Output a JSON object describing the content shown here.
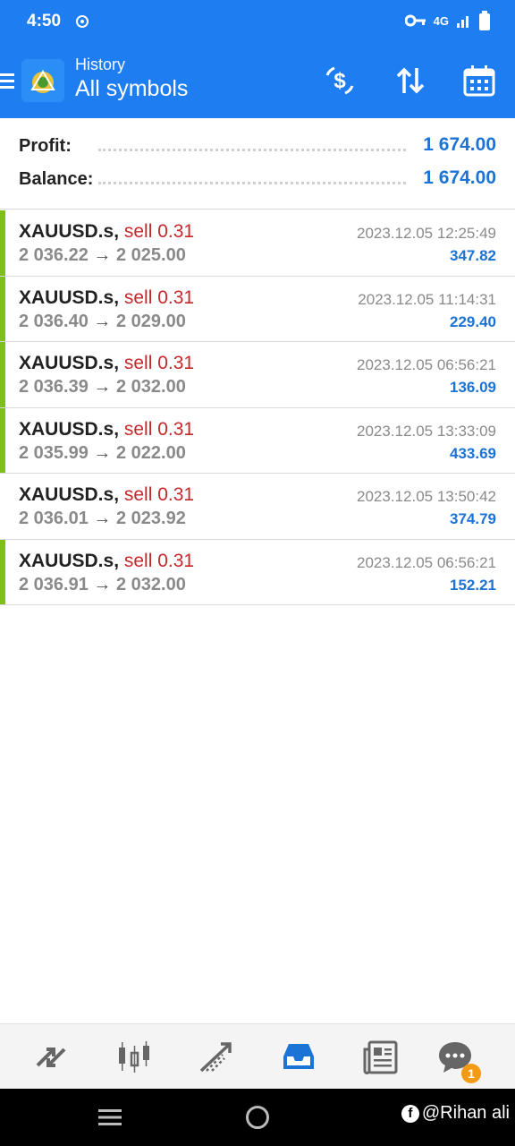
{
  "status": {
    "time": "4:50",
    "network": "4G"
  },
  "header": {
    "subtitle": "History",
    "title": "All symbols"
  },
  "summary": {
    "profit_label": "Profit:",
    "profit_value": "1 674.00",
    "balance_label": "Balance:",
    "balance_value": "1 674.00"
  },
  "deals": [
    {
      "symbol": "XAUUSD.s,",
      "side": "sell 0.31",
      "open": "2 036.22",
      "arrow": "→",
      "close": "2 025.00",
      "time": "2023.12.05 12:25:49",
      "profit": "347.82",
      "bar": true
    },
    {
      "symbol": "XAUUSD.s,",
      "side": "sell 0.31",
      "open": "2 036.40",
      "arrow": "→",
      "close": "2 029.00",
      "time": "2023.12.05 11:14:31",
      "profit": "229.40",
      "bar": true
    },
    {
      "symbol": "XAUUSD.s,",
      "side": "sell 0.31",
      "open": "2 036.39",
      "arrow": "→",
      "close": "2 032.00",
      "time": "2023.12.05 06:56:21",
      "profit": "136.09",
      "bar": true
    },
    {
      "symbol": "XAUUSD.s,",
      "side": "sell 0.31",
      "open": "2 035.99",
      "arrow": "→",
      "close": "2 022.00",
      "time": "2023.12.05 13:33:09",
      "profit": "433.69",
      "bar": true
    },
    {
      "symbol": "XAUUSD.s,",
      "side": "sell 0.31",
      "open": "2 036.01",
      "arrow": "→",
      "close": "2 023.92",
      "time": "2023.12.05 13:50:42",
      "profit": "374.79",
      "bar": false
    },
    {
      "symbol": "XAUUSD.s,",
      "side": "sell 0.31",
      "open": "2 036.91",
      "arrow": "→",
      "close": "2 032.00",
      "time": "2023.12.05 06:56:21",
      "profit": "152.21",
      "bar": true
    }
  ],
  "tabs": {
    "items": [
      "quotes-icon",
      "chart-icon",
      "trade-icon",
      "history-icon",
      "news-icon",
      "chat-icon"
    ],
    "active": "history-icon",
    "chat_badge": "1"
  },
  "watermark": {
    "fb": "f",
    "text": "@Rihan ali"
  },
  "colors": {
    "brand": "#1f7df2",
    "profit": "#1c73d6",
    "sell": "#c6282a",
    "win_bar": "#7fbf1a",
    "badge": "#f39a16"
  }
}
